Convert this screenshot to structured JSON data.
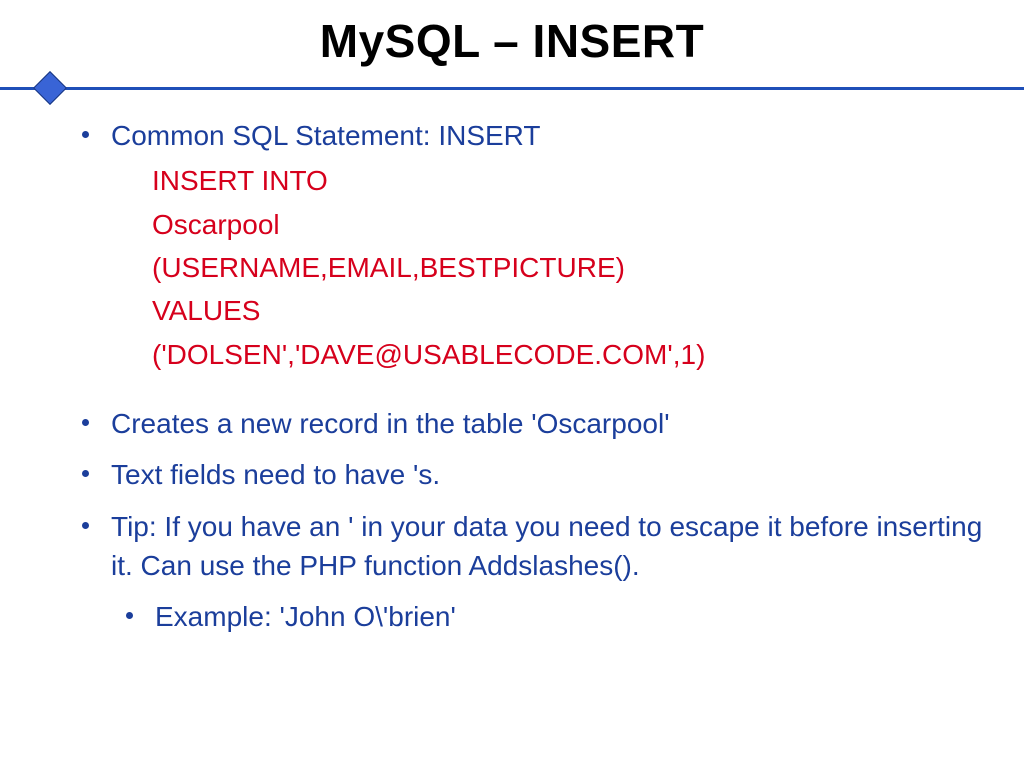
{
  "title": "MySQL – INSERT",
  "bullets": {
    "b1": "Common SQL Statement: INSERT",
    "b2": "Creates a new record in the table 'Oscarpool'",
    "b3": "Text fields need to have 's.",
    "b4": "Tip: If you have an ' in your data you need to escape it before inserting it. Can use the PHP function Addslashes().",
    "b5": "Example: 'John O\\'brien'"
  },
  "code": {
    "l1": "INSERT INTO",
    "l2": "Oscarpool",
    "l3": "(USERNAME,EMAIL,BESTPICTURE)",
    "l4": "VALUES",
    "l5": "('DOLSEN','DAVE@USABLECODE.COM',1)"
  }
}
